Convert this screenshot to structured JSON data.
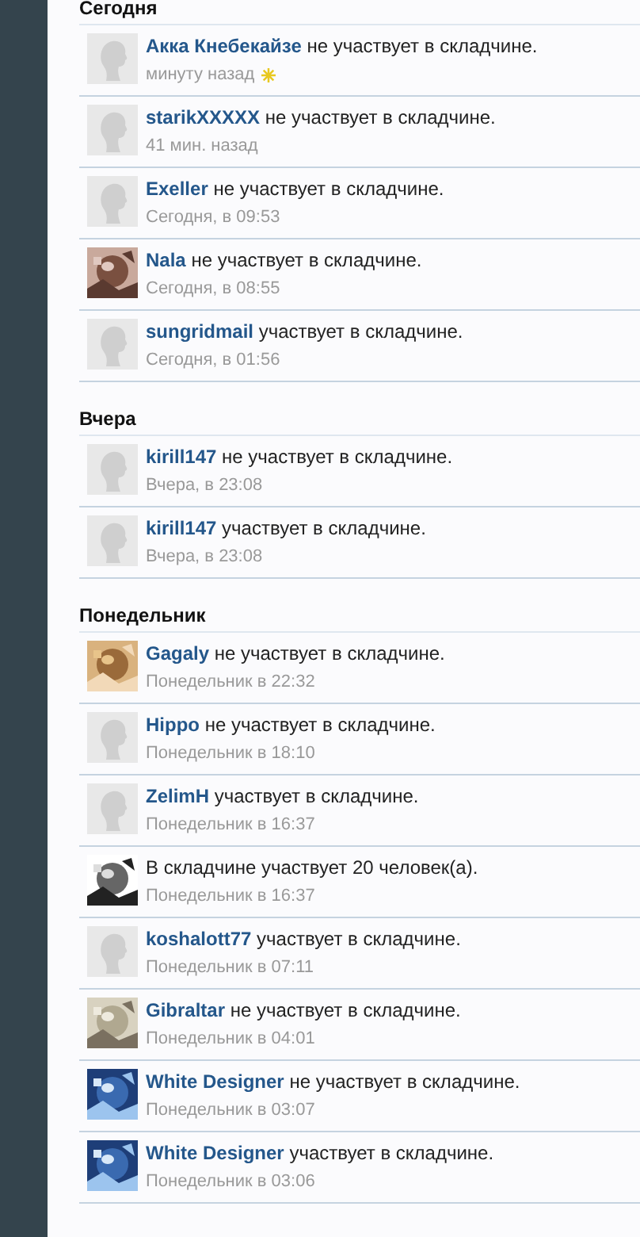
{
  "sections": [
    {
      "heading": "Сегодня",
      "items": [
        {
          "kind": "default",
          "user": "Акка Кнебекайзе",
          "message": "не участвует в складчине.",
          "time": "минуту назад",
          "new": true
        },
        {
          "kind": "default",
          "user": "starikXXXXX",
          "message": "не участвует в складчине.",
          "time": "41 мин. назад",
          "new": false
        },
        {
          "kind": "default",
          "user": "Exeller",
          "message": "не участвует в складчине.",
          "time": "Сегодня, в 09:53",
          "new": false
        },
        {
          "kind": "picture",
          "user": "Nala",
          "message": "не участвует в складчине.",
          "time": "Сегодня, в 08:55",
          "new": false
        },
        {
          "kind": "default",
          "user": "sungridmail",
          "message": "участвует в складчине.",
          "time": "Сегодня, в 01:56",
          "new": false
        }
      ]
    },
    {
      "heading": "Вчера",
      "items": [
        {
          "kind": "default",
          "user": "kirill147",
          "message": "не участвует в складчине.",
          "time": "Вчера, в 23:08",
          "new": false
        },
        {
          "kind": "default",
          "user": "kirill147",
          "message": "участвует в складчине.",
          "time": "Вчера, в 23:08",
          "new": false
        }
      ]
    },
    {
      "heading": "Понедельник",
      "items": [
        {
          "kind": "picture",
          "user": "Gagaly",
          "message": "не участвует в складчине.",
          "time": "Понедельник в 22:32",
          "new": false
        },
        {
          "kind": "default",
          "user": "Hippo",
          "message": "не участвует в складчине.",
          "time": "Понедельник в 18:10",
          "new": false
        },
        {
          "kind": "default",
          "user": "ZelimH",
          "message": "участвует в складчине.",
          "time": "Понедельник в 16:37",
          "new": false
        },
        {
          "kind": "picture",
          "message": "В складчине участвует 20 человек(а).",
          "time": "Понедельник в 16:37",
          "new": false
        },
        {
          "kind": "default",
          "user": "koshalott77",
          "message": "участвует в складчине.",
          "time": "Понедельник в 07:11",
          "new": false
        },
        {
          "kind": "picture",
          "user": "Gibraltar",
          "message": "не участвует в складчине.",
          "time": "Понедельник в 04:01",
          "new": false
        },
        {
          "kind": "picture",
          "user": "White Designer",
          "message": "не участвует в складчине.",
          "time": "Понедельник в 03:07",
          "new": false
        },
        {
          "kind": "picture",
          "user": "White Designer",
          "message": "участвует в складчине.",
          "time": "Понедельник в 03:06",
          "new": false
        }
      ]
    }
  ]
}
